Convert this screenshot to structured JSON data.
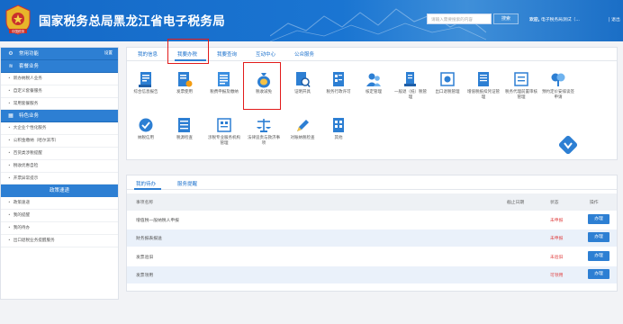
{
  "header": {
    "title": "国家税务总局黑龙江省电子税务局",
    "search_placeholder": "请输入需要搜索的内容",
    "search_button": "搜索",
    "welcome_prefix": "欢迎,",
    "welcome_user": "电子税务局测试（...",
    "divider": "|",
    "logout": "退出",
    "logo_text": "中国税务"
  },
  "sidebar": {
    "sections": [
      {
        "title": "常用功能",
        "icon": "gear-icon",
        "right": "设置",
        "items": []
      },
      {
        "title": "套餐业务",
        "icon": "layers-icon",
        "right": "",
        "items": [
          "新办纳税人业务",
          "自定义套餐服务",
          "常用套餐服务"
        ]
      },
      {
        "title": "特色业务",
        "icon": "grid-icon",
        "right": "",
        "items": [
          "大企业个性化服务",
          "公积金缴纳（哈尔滨市）",
          "百货类涉税提醒",
          "税收优惠自检",
          "开票异常提示"
        ]
      }
    ],
    "policy_title": "政策速递",
    "policy_items": [
      "政策速递",
      "我的提醒",
      "我的待办",
      "出口退税业务提醒服务"
    ]
  },
  "main": {
    "tabs": [
      "我的信息",
      "我要办税",
      "我要查询",
      "互动中心",
      "公众服务"
    ],
    "active_tab": 1,
    "icons_row1": [
      {
        "label": "综合信息报告",
        "icon": "book-icon"
      },
      {
        "label": "发票使用",
        "icon": "invoice-icon"
      },
      {
        "label": "税费申报及缴纳",
        "icon": "form-icon"
      },
      {
        "label": "税收减免",
        "icon": "money-bag-icon"
      },
      {
        "label": "证明开具",
        "icon": "certificate-icon"
      },
      {
        "label": "税务行政许可",
        "icon": "seal-icon"
      },
      {
        "label": "核定管理",
        "icon": "users-icon"
      },
      {
        "label": "一般退（抵）税管理",
        "icon": "refund-icon"
      },
      {
        "label": "出口退税管理",
        "icon": "export-icon"
      },
      {
        "label": "增值税抵扣凭证管理",
        "icon": "voucher-icon"
      },
      {
        "label": "税务代理前置审核管理",
        "icon": "agent-icon"
      },
      {
        "label": "预约定价安排谈签申请",
        "icon": "handshake-icon"
      }
    ],
    "icons_row2": [
      {
        "label": "纳税信用",
        "icon": "credit-icon"
      },
      {
        "label": "税源检查",
        "icon": "inspection-icon"
      },
      {
        "label": "涉税专业服务机构管理",
        "icon": "institution-icon"
      },
      {
        "label": "法律追责与救济事项",
        "icon": "scale-icon"
      },
      {
        "label": "对账纳税检查",
        "icon": "pen-icon"
      },
      {
        "label": "其他",
        "icon": "other-icon"
      }
    ]
  },
  "todo": {
    "tabs": [
      "我的待办",
      "服务提醒"
    ],
    "columns": [
      "事项名称",
      "截止日期",
      "状态",
      "操作"
    ],
    "rows": [
      {
        "name": "增值税一般纳税人申报",
        "deadline": "",
        "status": "未申报",
        "action": "办理"
      },
      {
        "name": "财务报表报送",
        "deadline": "",
        "status": "未申报",
        "action": "办理"
      },
      {
        "name": "发票验旧",
        "deadline": "",
        "status": "未验旧",
        "action": "办理"
      },
      {
        "name": "发票领用",
        "deadline": "",
        "status": "可领用",
        "action": "办理"
      }
    ]
  },
  "colors": {
    "brand_blue": "#1a70cc",
    "highlight_red": "#e21b1b",
    "status_red": "#e04545"
  }
}
